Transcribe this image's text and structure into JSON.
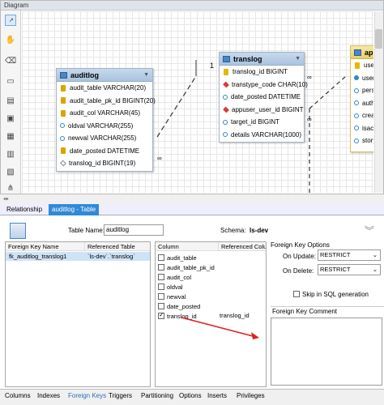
{
  "diagram": {
    "title": "Diagram"
  },
  "tools": [
    {
      "icon": "pointer-icon"
    },
    {
      "icon": "hand-icon"
    },
    {
      "icon": "eraser-icon"
    },
    {
      "icon": "layer-icon"
    },
    {
      "icon": "note-icon"
    },
    {
      "icon": "image-icon"
    },
    {
      "icon": "table-icon"
    },
    {
      "icon": "view-icon"
    },
    {
      "icon": "routine-icon"
    },
    {
      "icon": "relation-icon"
    }
  ],
  "entities": {
    "auditlog": {
      "name": "auditlog",
      "columns": [
        {
          "text": "audit_table VARCHAR(20)",
          "icon": "fk"
        },
        {
          "text": "audit_table_pk_id BIGINT(20)",
          "icon": "fk"
        },
        {
          "text": "audit_col VARCHAR(45)",
          "icon": "fk"
        },
        {
          "text": "oldval VARCHAR(255)",
          "icon": "col"
        },
        {
          "text": "newval VARCHAR(255)",
          "icon": "col"
        },
        {
          "text": "date_posted DATETIME",
          "icon": "fk"
        },
        {
          "text": "translog_id BIGINT(19)",
          "icon": "dia"
        }
      ]
    },
    "translog": {
      "name": "translog",
      "columns": [
        {
          "text": "translog_id BIGINT",
          "icon": "key"
        },
        {
          "text": "transtype_code CHAR(10)",
          "icon": "red"
        },
        {
          "text": "date_posted DATETIME",
          "icon": "col"
        },
        {
          "text": "appuser_user_id BIGINT",
          "icon": "red"
        },
        {
          "text": "target_id BIGINT",
          "icon": "col"
        },
        {
          "text": "details VARCHAR(1000)",
          "icon": "col"
        }
      ]
    },
    "appuser": {
      "name": "ap",
      "columns": [
        {
          "text": "user_",
          "icon": "key"
        },
        {
          "text": "user",
          "icon": "colf"
        },
        {
          "text": "perso",
          "icon": "col"
        },
        {
          "text": "autho",
          "icon": "col"
        },
        {
          "text": "creat",
          "icon": "col"
        },
        {
          "text": "isacti",
          "icon": "col"
        },
        {
          "text": "story",
          "icon": "col"
        }
      ]
    }
  },
  "relations": {
    "one": "1",
    "many1": "∞",
    "many2": "∞",
    "many3": "∞"
  },
  "tabs": [
    {
      "label": "Relationship"
    },
    {
      "label": "auditlog - Table"
    }
  ],
  "editor": {
    "table_name_label": "Table Name:",
    "table_name_value": "auditlog",
    "schema_label": "Schema:",
    "schema_value": "ls-dev",
    "fk_headers": [
      "Foreign Key Name",
      "Referenced Table"
    ],
    "fk_rows": [
      {
        "name": "fk_auditlog_translog1",
        "ref": "`ls-dev`.`translog`"
      }
    ],
    "col_headers": [
      "Column",
      "Referenced Column"
    ],
    "col_rows": [
      {
        "column": "audit_table",
        "ref": "",
        "checked": false
      },
      {
        "column": "audit_table_pk_id",
        "ref": "",
        "checked": false
      },
      {
        "column": "audit_col",
        "ref": "",
        "checked": false
      },
      {
        "column": "oldval",
        "ref": "",
        "checked": false
      },
      {
        "column": "newval",
        "ref": "",
        "checked": false
      },
      {
        "column": "date_posted",
        "ref": "",
        "checked": false
      },
      {
        "column": "translog_id",
        "ref": "translog_id",
        "checked": true
      }
    ],
    "options_title": "Foreign Key Options",
    "on_update_label": "On Update:",
    "on_update_value": "RESTRICT",
    "on_delete_label": "On Delete:",
    "on_delete_value": "RESTRICT",
    "skip_sql_label": "Skip in SQL generation",
    "comment_title": "Foreign Key Comment",
    "comment_value": ""
  },
  "bottom_tabs": [
    {
      "label": "Columns"
    },
    {
      "label": "Indexes"
    },
    {
      "label": "Foreign Keys",
      "active": true
    },
    {
      "label": "Triggers"
    },
    {
      "label": "Partitioning"
    },
    {
      "label": "Options"
    },
    {
      "label": "Inserts"
    },
    {
      "label": "Privileges"
    }
  ],
  "colors": {
    "accent": "#2f8ad8",
    "arrow": "#e02020",
    "header": "#a9c3df"
  }
}
